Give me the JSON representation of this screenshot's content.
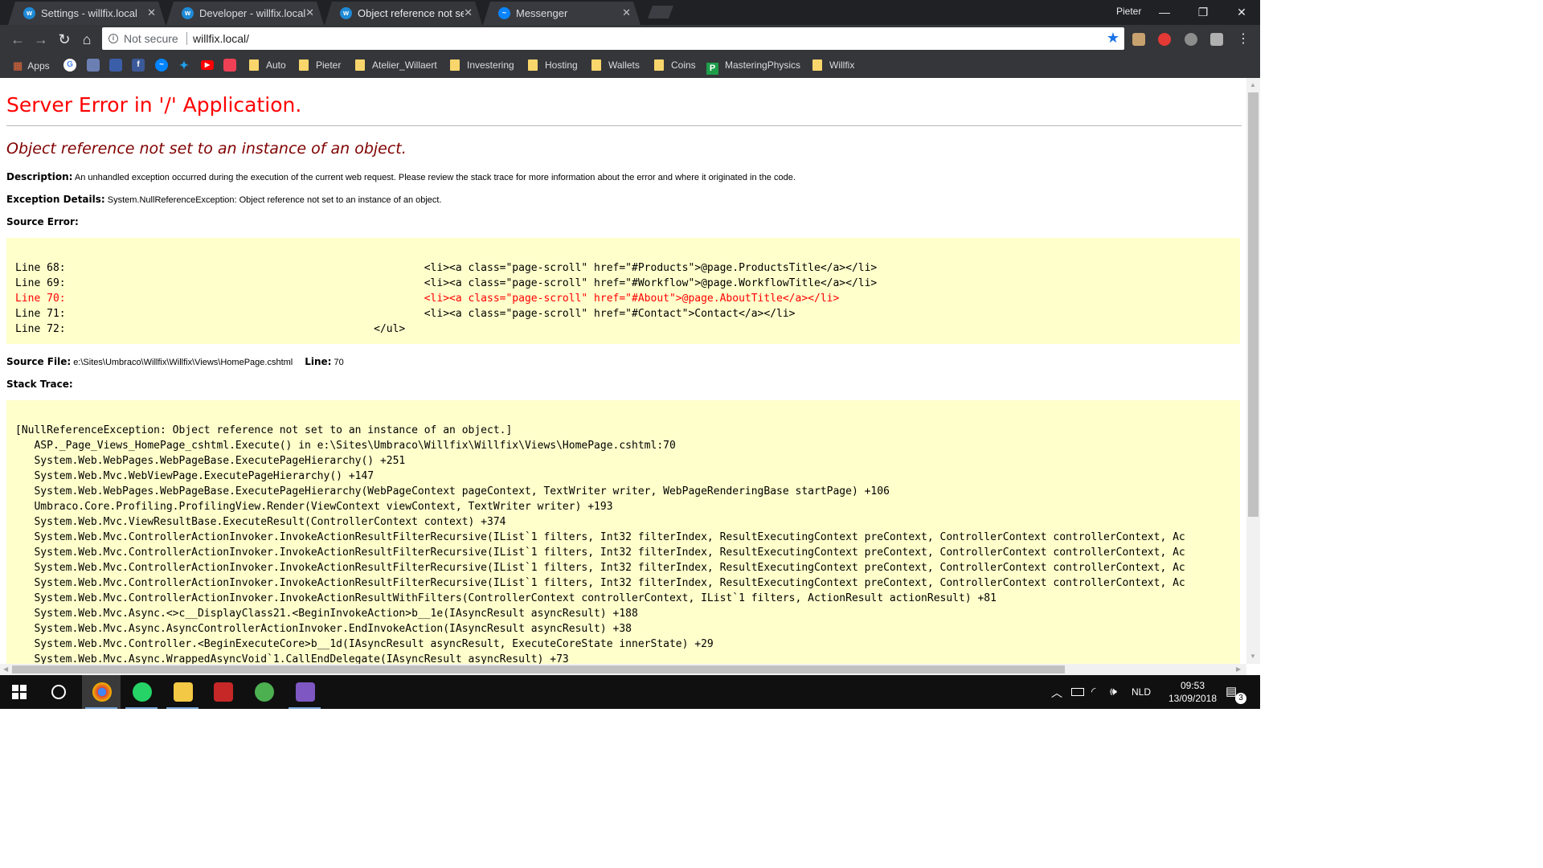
{
  "browser": {
    "tabs": [
      {
        "title": "Settings - willfix.local",
        "icon": "umbraco-icon"
      },
      {
        "title": "Developer - willfix.local",
        "icon": "umbraco-icon"
      },
      {
        "title": "Object reference not set",
        "icon": "umbraco-icon",
        "active": true
      },
      {
        "title": "Messenger",
        "icon": "messenger-icon"
      }
    ],
    "profile_name": "Pieter",
    "security_label": "Not secure",
    "url": "willfix.local/",
    "bookmarks": {
      "apps": "Apps",
      "folders": [
        "Auto",
        "Pieter",
        "Atelier_Willaert",
        "Investering",
        "Hosting",
        "Wallets",
        "Coins"
      ],
      "mastering": "MasteringPhysics",
      "last_folder": "Willfix"
    }
  },
  "page": {
    "title": "Server Error in '/' Application.",
    "message": "Object reference not set to an instance of an object.",
    "description_label": "Description:",
    "description_text": " An unhandled exception occurred during the execution of the current web request. Please review the stack trace for more information about the error and where it originated in the code.",
    "exception_label": "Exception Details:",
    "exception_text": " System.NullReferenceException: Object reference not set to an instance of an object.",
    "source_error_label": "Source Error:",
    "source_lines": [
      "Line 68:                                                         <li><a class=\"page-scroll\" href=\"#Products\">@page.ProductsTitle</a></li>",
      "Line 69:                                                         <li><a class=\"page-scroll\" href=\"#Workflow\">@page.WorkflowTitle</a></li>",
      "Line 70:                                                         <li><a class=\"page-scroll\" href=\"#About\">@page.AboutTitle</a></li>",
      "Line 71:                                                         <li><a class=\"page-scroll\" href=\"#Contact\">Contact</a></li>",
      "Line 72:                                                 </ul>"
    ],
    "highlighted_line_index": 2,
    "source_file_label": "Source File:",
    "source_file": " e:\\Sites\\Umbraco\\Willfix\\Willfix\\Views\\HomePage.cshtml",
    "line_label": "Line:",
    "line_value": " 70",
    "stack_trace_label": "Stack Trace:",
    "stack_lines": [
      "[NullReferenceException: Object reference not set to an instance of an object.]",
      "   ASP._Page_Views_HomePage_cshtml.Execute() in e:\\Sites\\Umbraco\\Willfix\\Willfix\\Views\\HomePage.cshtml:70",
      "   System.Web.WebPages.WebPageBase.ExecutePageHierarchy() +251",
      "   System.Web.Mvc.WebViewPage.ExecutePageHierarchy() +147",
      "   System.Web.WebPages.WebPageBase.ExecutePageHierarchy(WebPageContext pageContext, TextWriter writer, WebPageRenderingBase startPage) +106",
      "   Umbraco.Core.Profiling.ProfilingView.Render(ViewContext viewContext, TextWriter writer) +193",
      "   System.Web.Mvc.ViewResultBase.ExecuteResult(ControllerContext context) +374",
      "   System.Web.Mvc.ControllerActionInvoker.InvokeActionResultFilterRecursive(IList`1 filters, Int32 filterIndex, ResultExecutingContext preContext, ControllerContext controllerContext, Ac",
      "   System.Web.Mvc.ControllerActionInvoker.InvokeActionResultFilterRecursive(IList`1 filters, Int32 filterIndex, ResultExecutingContext preContext, ControllerContext controllerContext, Ac",
      "   System.Web.Mvc.ControllerActionInvoker.InvokeActionResultFilterRecursive(IList`1 filters, Int32 filterIndex, ResultExecutingContext preContext, ControllerContext controllerContext, Ac",
      "   System.Web.Mvc.ControllerActionInvoker.InvokeActionResultFilterRecursive(IList`1 filters, Int32 filterIndex, ResultExecutingContext preContext, ControllerContext controllerContext, Ac",
      "   System.Web.Mvc.ControllerActionInvoker.InvokeActionResultWithFilters(ControllerContext controllerContext, IList`1 filters, ActionResult actionResult) +81",
      "   System.Web.Mvc.Async.<>c__DisplayClass21.<BeginInvokeAction>b__1e(IAsyncResult asyncResult) +188",
      "   System.Web.Mvc.Async.AsyncControllerActionInvoker.EndInvokeAction(IAsyncResult asyncResult) +38",
      "   System.Web.Mvc.Controller.<BeginExecuteCore>b__1d(IAsyncResult asyncResult, ExecuteCoreState innerState) +29",
      "   System.Web.Mvc.Async.WrappedAsyncVoid`1.CallEndDelegate(IAsyncResult asyncResult) +73"
    ]
  },
  "taskbar": {
    "apps": [
      "chrome-icon",
      "whatsapp-icon",
      "file-explorer-icon",
      "app-icon",
      "xbox-app-icon",
      "visual-studio-icon"
    ],
    "language": "NLD",
    "time": "09:53",
    "date": "13/09/2018",
    "notification_count": "3"
  },
  "colors": {
    "error_red": "#ff0000",
    "message_maroon": "#800000",
    "code_background": "#ffffcc"
  }
}
